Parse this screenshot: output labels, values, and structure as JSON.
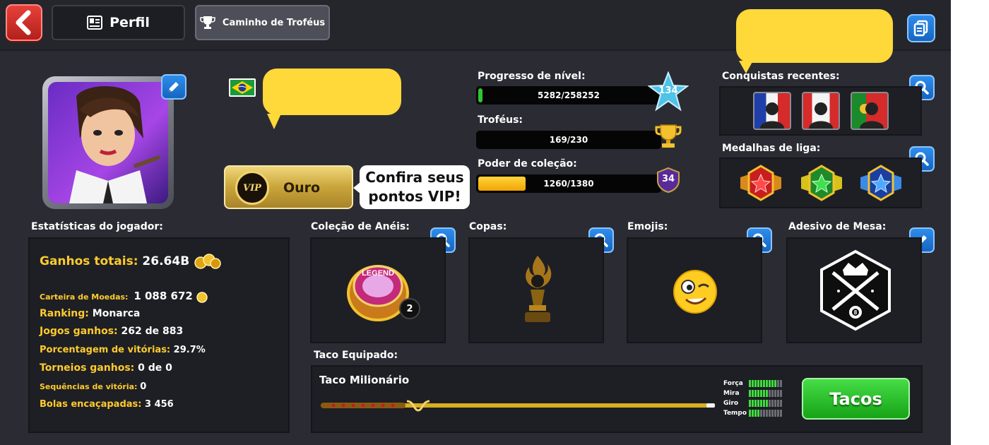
{
  "tabs": {
    "perfil": "Perfil",
    "trophy_road": "Caminho de Troféus"
  },
  "profile": {
    "flag": "Brasil",
    "vip": {
      "level": "Ouro",
      "badge": "VIP"
    },
    "vip_tip": {
      "line1": "Confira seus",
      "line2": "pontos VIP!"
    }
  },
  "progress": {
    "level_label": "Progresso de nível:",
    "level_value": "5282/258252",
    "level_fraction": 0.02,
    "level_number": "134",
    "trophies_label": "Troféus:",
    "trophies_value": "169/230",
    "trophies_fraction": 0.0,
    "collection_label": "Poder de coleção:",
    "collection_value": "1260/1380",
    "collection_fraction": 0.26,
    "collection_badge": "34"
  },
  "achievements": {
    "label": "Conquistas recentes:",
    "items": [
      "França",
      "Canadá",
      "Portugal"
    ]
  },
  "league": {
    "label": "Medalhas de liga:",
    "items": [
      "red-star-medal",
      "green-star-medal",
      "blue-star-medal"
    ]
  },
  "stats": {
    "label": "Estatísticas do jogador:",
    "total_earnings_label": "Ganhos totais:",
    "total_earnings_value": "26.64B",
    "wallet_label": "Carteira de Moedas:",
    "wallet_value": "1 088 672",
    "ranking_label": "Ranking:",
    "ranking_value": "Monarca",
    "games_won_label": "Jogos ganhos:",
    "games_won_value": "262 de 883",
    "win_pct_label": "Porcentagem de vitórias:",
    "win_pct_value": "29.7%",
    "tournaments_label": "Torneios ganhos:",
    "tournaments_value": "0 de 0",
    "streaks_label": "Sequências de vitória:",
    "streaks_value": "0",
    "potted_label": "Bolas encaçapadas:",
    "potted_value": "3 456"
  },
  "collections": {
    "rings_label": "Coleção de Anéis:",
    "rings_count": "2",
    "ring_text": "LEGEND",
    "cups_label": "Copas:",
    "emojis_label": "Emojis:",
    "decal_label": "Adesivo de Mesa:",
    "decal_ball": "8"
  },
  "cue": {
    "label": "Taco Equipado:",
    "name": "Taco Milionário",
    "stats": [
      {
        "name": "Força",
        "level": 10,
        "max": 12
      },
      {
        "name": "Mira",
        "level": 7,
        "max": 12
      },
      {
        "name": "Giro",
        "level": 7,
        "max": 12
      },
      {
        "name": "Tempo",
        "level": 4,
        "max": 12
      }
    ],
    "button": "Tacos"
  },
  "colors": {
    "accent_yellow": "#ffcb2e",
    "bubble_yellow": "#ffd83a",
    "button_blue": "#1e7be0",
    "button_green": "#22b822"
  }
}
